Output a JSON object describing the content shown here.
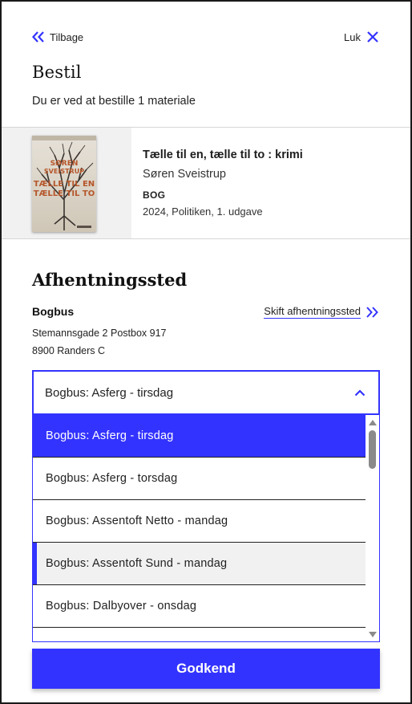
{
  "nav": {
    "back_label": "Tilbage",
    "close_label": "Luk"
  },
  "header": {
    "title": "Bestil",
    "subtitle": "Du er ved at bestille 1 materiale"
  },
  "material": {
    "title": "Tælle til en, tælle til to : krimi",
    "author": "Søren Sveistrup",
    "type": "BOG",
    "edition": "2024, Politiken, 1. udgave",
    "cover": {
      "author_text": "SØREN SVEISTRUP",
      "title_text": "TÆLLE TIL EN TÆLLE TIL TO"
    }
  },
  "pickup": {
    "section_title": "Afhentningssted",
    "branch_name": "Bogbus",
    "change_label": "Skift afhentningssted",
    "address_line1": "Stemannsgade 2 Postbox 917",
    "address_line2": "8900 Randers C"
  },
  "select": {
    "value": "Bogbus: Asferg - tirsdag",
    "options": [
      {
        "label": "Bogbus: Asferg - tirsdag",
        "state": "selected"
      },
      {
        "label": "Bogbus: Asferg - torsdag",
        "state": "normal"
      },
      {
        "label": "Bogbus: Assentoft Netto - mandag",
        "state": "normal"
      },
      {
        "label": "Bogbus: Assentoft Sund - mandag",
        "state": "hover"
      },
      {
        "label": "Bogbus: Dalbyover - onsdag",
        "state": "normal"
      }
    ]
  },
  "actions": {
    "approve_label": "Godkend"
  },
  "colors": {
    "accent": "#3333ff",
    "hover_bg": "#f1f1f1",
    "text": "#212121"
  }
}
